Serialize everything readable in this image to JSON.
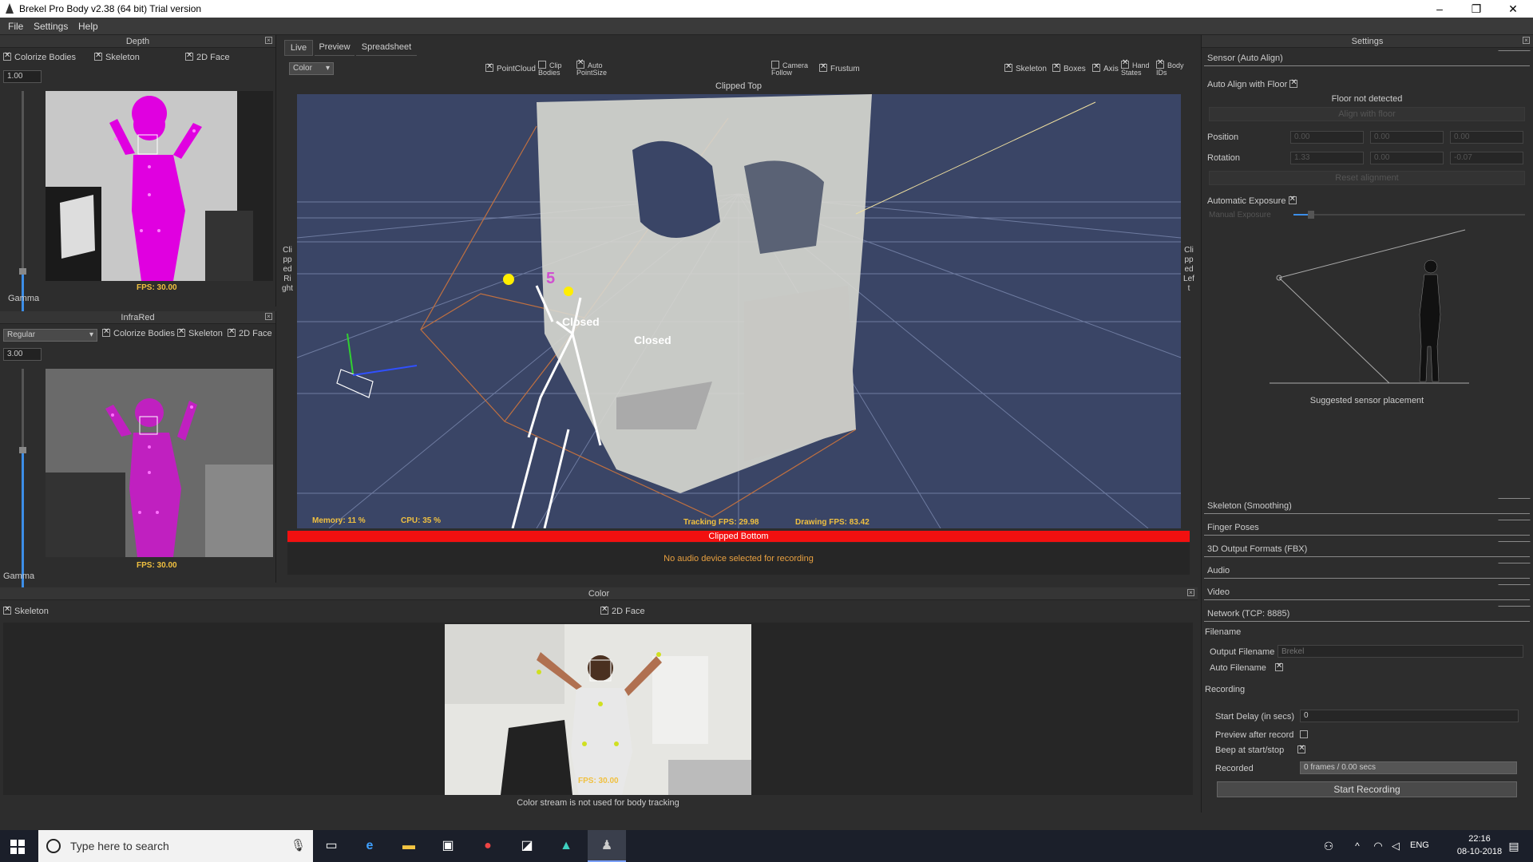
{
  "window": {
    "title": "Brekel Pro Body v2.38 (64 bit)   Trial version",
    "minimize": "–",
    "maximize": "❐",
    "close": "✕"
  },
  "menu": [
    "File",
    "Settings",
    "Help"
  ],
  "depth": {
    "title": "Depth",
    "colorize": "Colorize Bodies",
    "skeleton": "Skeleton",
    "face": "2D Face",
    "value": "1.00",
    "gamma": "Gamma",
    "fps": "FPS: 30.00"
  },
  "infrared": {
    "title": "InfraRed",
    "mode": "Regular",
    "colorize": "Colorize Bodies",
    "skeleton": "Skeleton",
    "face": "2D Face",
    "value": "3.00",
    "gamma": "Gamma",
    "fps": "FPS: 30.00"
  },
  "viewport": {
    "tabs": [
      "Live",
      "Preview",
      "Spreadsheet"
    ],
    "mode": "Color",
    "pointcloud": "PointCloud",
    "clip_bodies": "Clip Bodies",
    "auto_pointsize": "Auto PointSize",
    "camera_follow": "Camera Follow",
    "frustum": "Frustum",
    "skeleton": "Skeleton",
    "boxes": "Boxes",
    "axis": "Axis",
    "hand_states": "Hand States",
    "body_ids": "Body IDs",
    "clipped_top": "Clipped Top",
    "clipped_right": "Clipped Right",
    "clipped_left": "Clipped Left",
    "clipped_bottom": "Clipped Bottom",
    "body_id": "5",
    "hand_left": "Closed",
    "hand_right": "Closed",
    "memory": "Memory:  11 %",
    "cpu": "CPU:  35 %",
    "tracking_fps": "Tracking FPS: 29.98",
    "drawing_fps": "Drawing FPS: 83.42",
    "audio_msg": "No audio device selected for recording"
  },
  "color": {
    "title": "Color",
    "skeleton": "Skeleton",
    "face": "2D Face",
    "fps": "FPS: 30.00",
    "note": "Color stream is not used for body tracking"
  },
  "settings": {
    "title": "Settings",
    "sensor_section": "Sensor (Auto Align)",
    "auto_align": "Auto Align with Floor",
    "floor_status": "Floor not detected",
    "align_btn": "Align with floor",
    "position": "Position",
    "position_vals": [
      "0.00",
      "0.00",
      "0.00"
    ],
    "rotation": "Rotation",
    "rotation_vals": [
      "1.33",
      "0.00",
      "-0.07"
    ],
    "reset_btn": "Reset alignment",
    "auto_exposure": "Automatic Exposure",
    "manual_exposure": "Manual Exposure",
    "placement": "Suggested sensor placement",
    "sections": [
      "Skeleton (Smoothing)",
      "Finger Poses",
      "3D Output Formats (FBX)",
      "Audio",
      "Video",
      "Network (TCP: 8885)"
    ],
    "filename_h": "Filename",
    "output_filename": "Output Filename",
    "output_placeholder": "Brekel",
    "auto_filename": "Auto Filename",
    "recording_h": "Recording",
    "start_delay": "Start Delay (in secs)",
    "start_delay_val": "0",
    "preview_after": "Preview after record",
    "beep": "Beep at start/stop",
    "recorded": "Recorded",
    "recorded_val": "0 frames / 0.00 secs",
    "start_btn": "Start Recording"
  },
  "taskbar": {
    "search": "Type here to search",
    "lang": "ENG",
    "time": "22:16",
    "date": "08-10-2018"
  }
}
